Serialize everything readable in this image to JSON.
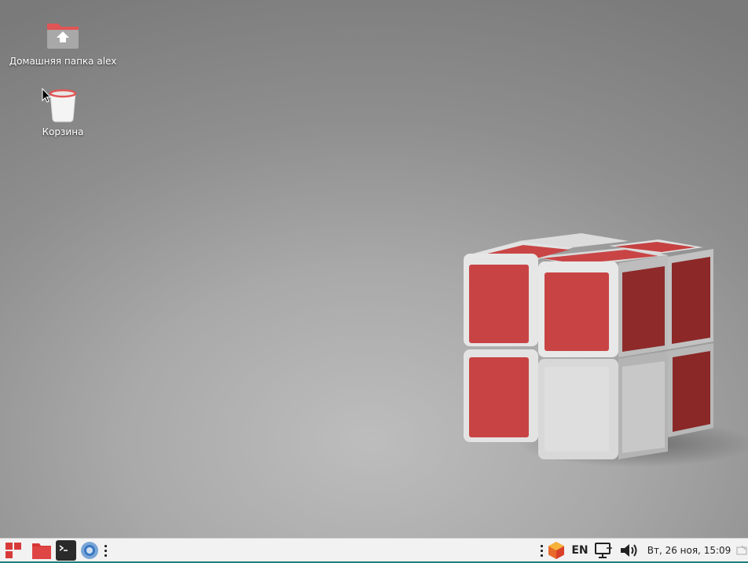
{
  "desktop": {
    "icons": [
      {
        "label": "Домашняя папка alex",
        "icon": "home-folder-icon"
      },
      {
        "label": "Корзина",
        "icon": "trash-icon"
      }
    ],
    "wallpaper": "cube-wallpaper"
  },
  "taskbar": {
    "launchers": [
      {
        "icon": "start-menu-icon"
      },
      {
        "icon": "file-manager-icon"
      },
      {
        "icon": "terminal-icon"
      },
      {
        "icon": "browser-icon"
      }
    ],
    "tray": {
      "keyboard_layout": "EN",
      "clock": "Вт, 26 ноя, 15:09"
    }
  },
  "colors": {
    "accent_red": "#d94a4a",
    "taskbar_bg": "#f2f2f2",
    "taskbar_bottom": "#1e7f7f"
  }
}
